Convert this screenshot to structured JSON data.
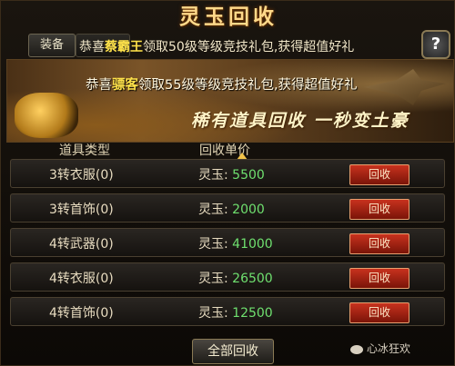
{
  "window": {
    "title": "灵玉回收"
  },
  "tabs": {
    "equip_label": "装备"
  },
  "help": {
    "label": "?"
  },
  "broadcast_top": {
    "prefix": "恭喜",
    "player": "蔡霸王",
    "suffix": "领取50级等级竞技礼包,获得超值好礼"
  },
  "banner": {
    "prefix": "恭喜",
    "player": "骠客",
    "suffix": "领取55级等级竞技礼包,获得超值好礼",
    "slogan": "稀有道具回收 一秒变土豪"
  },
  "table": {
    "headers": {
      "type": "道具类型",
      "price": "回收单价"
    },
    "currency_label": "灵玉:",
    "button_label": "回收",
    "rows": [
      {
        "name": "3转衣服(0)",
        "price": "5500"
      },
      {
        "name": "3转首饰(0)",
        "price": "2000"
      },
      {
        "name": "4转武器(0)",
        "price": "41000"
      },
      {
        "name": "4转衣服(0)",
        "price": "26500"
      },
      {
        "name": "4转首饰(0)",
        "price": "12500"
      }
    ]
  },
  "footer": {
    "recycle_all_label": "全部回收"
  },
  "watermark": {
    "text": "心冰狂欢"
  },
  "colors": {
    "accent": "#ffe24a",
    "price_green": "#6fe06f",
    "button_red": "#c8321e"
  }
}
